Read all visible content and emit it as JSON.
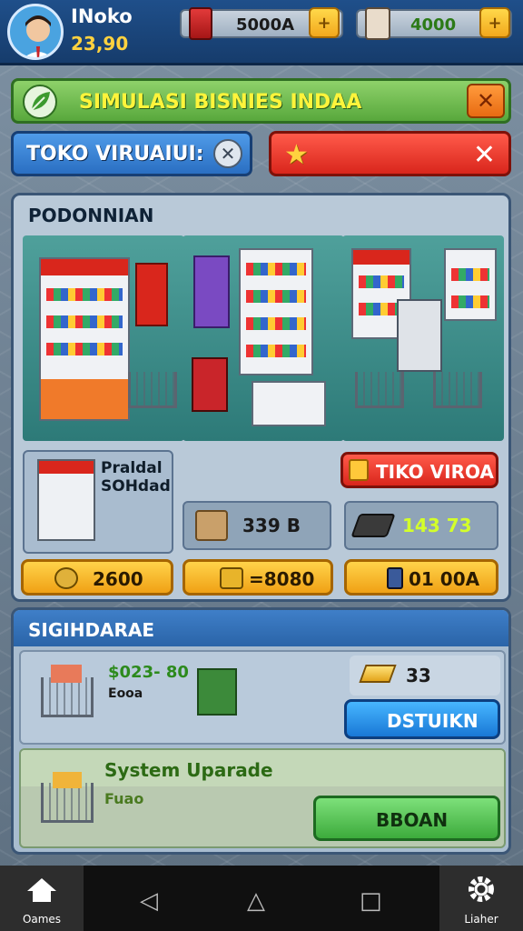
{
  "player": {
    "name": "INoko",
    "money": "23,90"
  },
  "resources": [
    {
      "value": "5000A",
      "icon": "paint-can-icon"
    },
    {
      "value": "4000",
      "icon": "manager-portrait-icon"
    }
  ],
  "title_banner": {
    "text": "SIMULASI BISNIES INDAA"
  },
  "search": {
    "text": "TOKO VIRUAIUI:"
  },
  "panel1": {
    "heading": "PODONNIAN",
    "shop_name": "Praldal\nSOHdad",
    "rent_button": "TIKO VIROA",
    "stat1": "339 B",
    "stat2": "143 73",
    "cost1": "2600",
    "cost2": "=8080",
    "cost3": "01 00A"
  },
  "panel2": {
    "heading": "SIGIHDARAE",
    "price_line": "$023- 80",
    "price_sub": "Eooa",
    "gold_value": "33",
    "action_button": "DSTUIKN",
    "upgrade_title": "System Uparade",
    "upgrade_sub": "Fuao",
    "buy_button": "BBOAN"
  },
  "navbar": {
    "left_label": "Oames",
    "right_label": "Liaher"
  },
  "colors": {
    "accent_gold": "#ffd23f",
    "green_title": "#fff43b",
    "text_green": "#d4ff2a"
  }
}
